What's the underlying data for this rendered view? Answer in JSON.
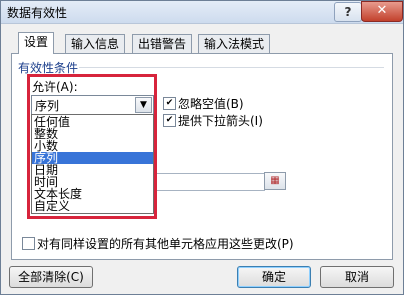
{
  "window": {
    "title": "数据有效性",
    "help_glyph": "?",
    "close_glyph": "✕"
  },
  "tabs": [
    {
      "label": "设置",
      "active": true
    },
    {
      "label": "输入信息",
      "active": false
    },
    {
      "label": "出错警告",
      "active": false
    },
    {
      "label": "输入法模式",
      "active": false
    }
  ],
  "criteria": {
    "group_label": "有效性条件",
    "allow_label": "允许(A):",
    "allow_value": "序列",
    "options": [
      "任何值",
      "整数",
      "小数",
      "序列",
      "日期",
      "时间",
      "文本长度",
      "自定义"
    ],
    "selected_index": 3,
    "ignore_blank_label": "忽略空值(B)",
    "ignore_blank_checked": true,
    "dropdown_label": "提供下拉箭头(I)",
    "dropdown_checked": true
  },
  "apply_all_label": "对有同样设置的所有其他单元格应用这些更改(P)",
  "apply_all_checked": false,
  "buttons": {
    "clear_all": "全部清除(C)",
    "ok": "确定",
    "cancel": "取消"
  },
  "colors": {
    "highlight": "#3874d8",
    "annotation_border": "#d7243c"
  }
}
